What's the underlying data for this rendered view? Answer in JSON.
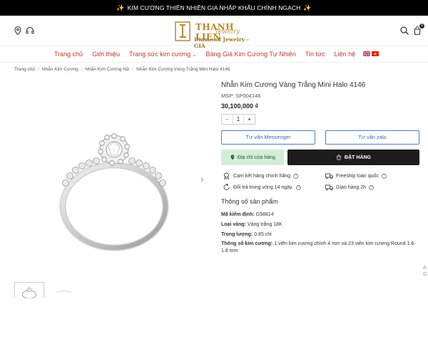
{
  "announcement": {
    "text": "KIM CƯƠNG THIÊN NHIÊN GIA NHẬP KHẨU CHÍNH NGẠCH"
  },
  "header": {
    "logo": {
      "name": "THANH LIEN",
      "script": "Jewelry",
      "subtitle": "Diamond Jewelry - GIA"
    },
    "cart_count": "0"
  },
  "nav": {
    "items": [
      {
        "label": "Trang chủ"
      },
      {
        "label": "Giới thiệu"
      },
      {
        "label": "Trang sức kim cương"
      },
      {
        "label": "Bảng Giá Kim Cương Tự Nhiên"
      },
      {
        "label": "Tin tức"
      },
      {
        "label": "Liên hệ"
      }
    ]
  },
  "breadcrumb": [
    "Trang chủ",
    "Nhẫn Kim Cương",
    "Nhẫn Kim Cương Nữ",
    "Nhẫn Kim Cương Vàng Trắng Mini Halo 4146"
  ],
  "product": {
    "title": "Nhẫn Kim Cương Vàng Trắng Mini Halo 4146",
    "sku": "MSP: SP004146",
    "price": "30,100,000 ₫",
    "qty": {
      "minus": "-",
      "value": "1",
      "plus": "+"
    },
    "btn_messenger": "Tư vấn Messenger",
    "btn_zalo": "Tư vấn zalo",
    "btn_store": "Địa chỉ cửa hàng",
    "btn_order": "ĐẶT HÀNG"
  },
  "policies": [
    {
      "label": "Cam kết hàng chính hãng",
      "icon": "certificate-icon"
    },
    {
      "label": "Freeship toàn quốc",
      "icon": "truck-icon"
    },
    {
      "label": "Đổi trả trong vòng 14 ngày.",
      "icon": "return-icon"
    },
    {
      "label": "Giao hàng 2h",
      "icon": "delivery-icon"
    }
  ],
  "specs": {
    "title": "Thông số sản phẩm",
    "rows": [
      {
        "key": "Mã kiểm định:",
        "value": "G58814"
      },
      {
        "key": "Loại vàng:",
        "value": "Vàng trắng 18K"
      },
      {
        "key": "Trọng lượng:",
        "value": "0.85 chỉ"
      },
      {
        "key": "Thông số kim cương:",
        "value": "1 viên kim cương chính 4 mm và 23 viên kim cương Round 1.6-1.8 mm"
      }
    ]
  },
  "colors": {
    "accent_red": "#c0392b",
    "gold": "#b58a2e",
    "button_blue": "#4a7bd0",
    "store_green": "#d5ecd8",
    "order_dark": "#1c1c1c"
  }
}
